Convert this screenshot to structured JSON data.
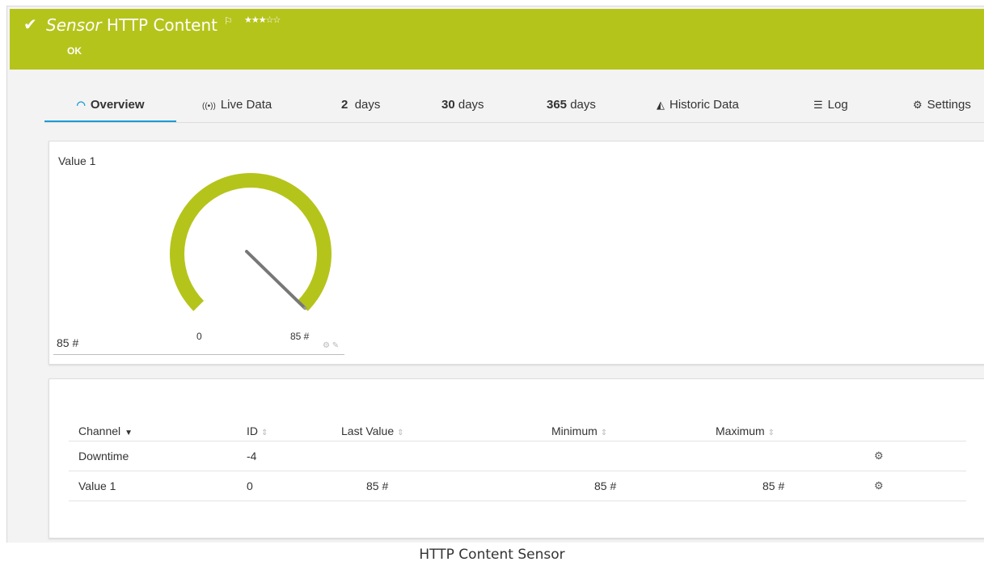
{
  "header": {
    "sensor_kind": "Sensor",
    "sensor_name": "HTTP Content",
    "status": "OK",
    "check_icon": "check-icon",
    "flag_icon": "flag-icon",
    "stars": "★★★☆☆",
    "priority": 3,
    "color": "#b5c41b"
  },
  "tabs": [
    {
      "label": "Overview",
      "icon": "gauge-icon",
      "active": true
    },
    {
      "label": "Live Data",
      "icon": "live-icon"
    },
    {
      "number": "2",
      "label": "days"
    },
    {
      "number": "30",
      "label": "days"
    },
    {
      "number": "365",
      "label": "days"
    },
    {
      "label": "Historic Data",
      "icon": "area-chart-icon"
    },
    {
      "label": "Log",
      "icon": "list-icon"
    },
    {
      "label": "Settings",
      "icon": "gear-icon"
    }
  ],
  "gauge": {
    "label": "Value 1",
    "value_text": "85 #",
    "min_label": "0",
    "max_label": "85 #",
    "value": 85,
    "min": 0,
    "max": 85,
    "color": "#b5c41b"
  },
  "table": {
    "columns": [
      "Channel",
      "ID",
      "Last Value",
      "Minimum",
      "Maximum"
    ],
    "rows": [
      {
        "channel": "Downtime",
        "id": "-4",
        "last": "",
        "min": "",
        "max": ""
      },
      {
        "channel": "Value 1",
        "id": "0",
        "last": "85 #",
        "min": "85 #",
        "max": "85 #"
      }
    ]
  },
  "caption": "HTTP Content Sensor"
}
